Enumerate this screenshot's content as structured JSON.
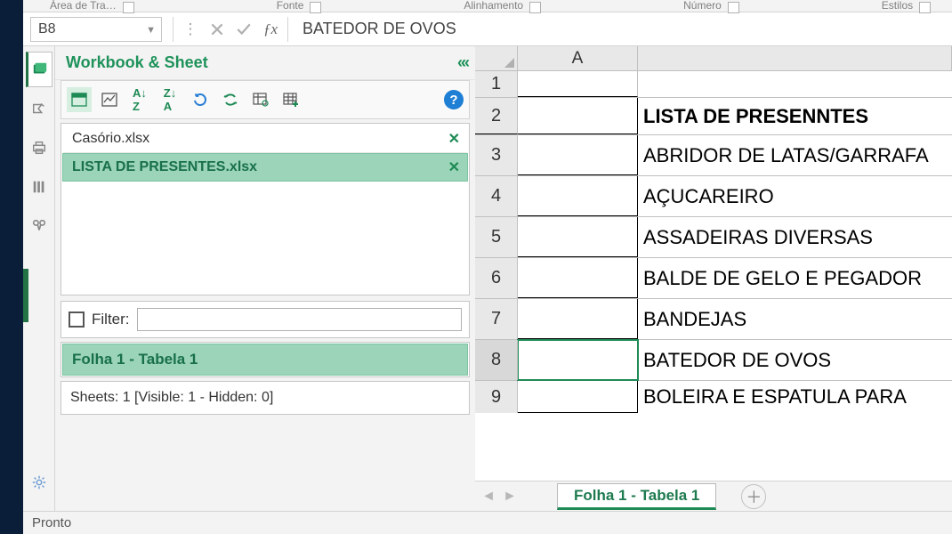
{
  "ribbon": {
    "groups": [
      "Área de Tra…",
      "Fonte",
      "Alinhamento",
      "Número",
      "Estilos"
    ]
  },
  "formula_bar": {
    "cell_ref": "B8",
    "value": "BATEDOR DE OVOS"
  },
  "panel": {
    "title": "Workbook & Sheet",
    "workbooks": [
      {
        "name": "Casório.xlsx",
        "selected": false
      },
      {
        "name": "LISTA DE PRESENTES.xlsx",
        "selected": true
      }
    ],
    "filter_label": "Filter:",
    "sheets": [
      {
        "name": "Folha 1 - Tabela 1",
        "selected": true
      }
    ],
    "stats": "Sheets: 1  [Visible: 1 - Hidden: 0]"
  },
  "grid": {
    "col_header": "A",
    "rows": [
      {
        "num": "1",
        "a": ""
      },
      {
        "num": "2",
        "a": "LISTA DE PRESENNTES"
      },
      {
        "num": "3",
        "a": "ABRIDOR DE LATAS/GARRAFA"
      },
      {
        "num": "4",
        "a": "AÇUCAREIRO"
      },
      {
        "num": "5",
        "a": "ASSADEIRAS DIVERSAS"
      },
      {
        "num": "6",
        "a": "BALDE DE GELO E PEGADOR"
      },
      {
        "num": "7",
        "a": "BANDEJAS"
      },
      {
        "num": "8",
        "a": "BATEDOR DE OVOS"
      },
      {
        "num": "9",
        "a": "BOLEIRA  E ESPATULA PARA"
      }
    ],
    "selected_row": "8"
  },
  "sheet_tabs": {
    "active": "Folha 1 - Tabela 1"
  },
  "status": "Pronto"
}
